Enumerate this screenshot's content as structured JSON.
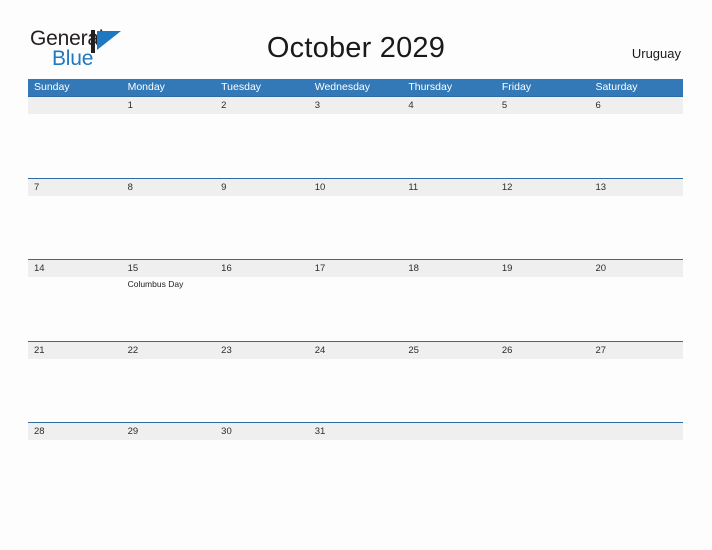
{
  "brand": {
    "name_part1": "General",
    "name_part2": "Blue",
    "mark_icon": "blue-triangle-flag-icon",
    "accent_color": "#1F79C0",
    "text_color": "#231F20"
  },
  "header": {
    "title": "October 2029",
    "country": "Uruguay"
  },
  "calendar": {
    "header_bg_color": "#3479B7",
    "band_bg_color": "#EFEFEF",
    "row_line_color": "#2E6DA4",
    "weekdays": [
      "Sunday",
      "Monday",
      "Tuesday",
      "Wednesday",
      "Thursday",
      "Friday",
      "Saturday"
    ],
    "weeks": [
      {
        "days": [
          {
            "date": "",
            "events": []
          },
          {
            "date": "1",
            "events": []
          },
          {
            "date": "2",
            "events": []
          },
          {
            "date": "3",
            "events": []
          },
          {
            "date": "4",
            "events": []
          },
          {
            "date": "5",
            "events": []
          },
          {
            "date": "6",
            "events": []
          }
        ]
      },
      {
        "days": [
          {
            "date": "7",
            "events": []
          },
          {
            "date": "8",
            "events": []
          },
          {
            "date": "9",
            "events": []
          },
          {
            "date": "10",
            "events": []
          },
          {
            "date": "11",
            "events": []
          },
          {
            "date": "12",
            "events": []
          },
          {
            "date": "13",
            "events": []
          }
        ]
      },
      {
        "days": [
          {
            "date": "14",
            "events": []
          },
          {
            "date": "15",
            "events": [
              "Columbus Day"
            ]
          },
          {
            "date": "16",
            "events": []
          },
          {
            "date": "17",
            "events": []
          },
          {
            "date": "18",
            "events": []
          },
          {
            "date": "19",
            "events": []
          },
          {
            "date": "20",
            "events": []
          }
        ]
      },
      {
        "days": [
          {
            "date": "21",
            "events": []
          },
          {
            "date": "22",
            "events": []
          },
          {
            "date": "23",
            "events": []
          },
          {
            "date": "24",
            "events": []
          },
          {
            "date": "25",
            "events": []
          },
          {
            "date": "26",
            "events": []
          },
          {
            "date": "27",
            "events": []
          }
        ]
      },
      {
        "days": [
          {
            "date": "28",
            "events": []
          },
          {
            "date": "29",
            "events": []
          },
          {
            "date": "30",
            "events": []
          },
          {
            "date": "31",
            "events": []
          },
          {
            "date": "",
            "events": []
          },
          {
            "date": "",
            "events": []
          },
          {
            "date": "",
            "events": []
          }
        ]
      }
    ]
  }
}
